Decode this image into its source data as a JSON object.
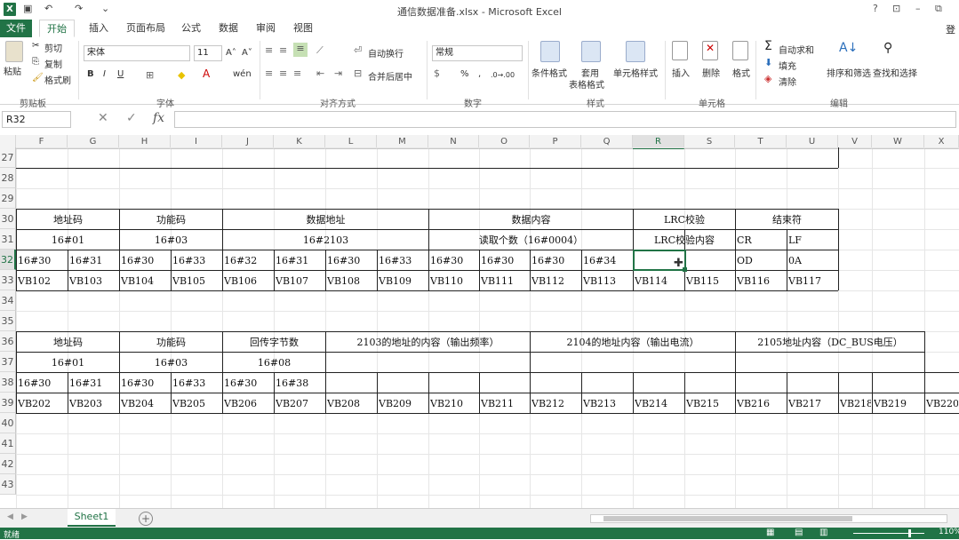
{
  "app": {
    "title": "通信数据准备.xlsx - Microsoft Excel",
    "help": "?",
    "restore": "⊡",
    "minimize": "–",
    "maximize": "⧉",
    "close": "✕",
    "login": "登"
  },
  "tabs": [
    "文件",
    "开始",
    "插入",
    "页面布局",
    "公式",
    "数据",
    "审阅",
    "视图"
  ],
  "ribbon": {
    "clipboard": {
      "paste": "粘贴",
      "cut": "剪切",
      "copy": "复制",
      "format_painter": "格式刷",
      "group": "剪贴板"
    },
    "font": {
      "name": "宋体",
      "size": "11",
      "bold": "B",
      "italic": "I",
      "underline": "U",
      "grow": "A˄",
      "shrink": "A˅",
      "wen": "wén",
      "group": "字体"
    },
    "align": {
      "wrap": "自动换行",
      "merge": "合并后居中",
      "group": "对齐方式"
    },
    "number": {
      "format": "常规",
      "percent": "%",
      "comma": ",",
      "inc": ".0→.00",
      "dec": ".00→.0",
      "group": "数字"
    },
    "styles": {
      "cond": "条件格式",
      "table_line1": "套用",
      "table_line2": "表格格式",
      "cell": "单元格样式",
      "group": "样式"
    },
    "cells": {
      "insert": "插入",
      "delete": "删除",
      "format": "格式",
      "group": "单元格"
    },
    "editing": {
      "autosum": "自动求和",
      "fill": "填充",
      "clear": "清除",
      "sort": "排序和筛选",
      "find": "查找和选择",
      "group": "编辑"
    }
  },
  "formula_bar": {
    "name_box": "R32",
    "fx": "fx",
    "value": ""
  },
  "columns": [
    "F",
    "G",
    "H",
    "I",
    "J",
    "K",
    "L",
    "M",
    "N",
    "O",
    "P",
    "Q",
    "R",
    "S",
    "T",
    "U",
    "V",
    "W",
    "X"
  ],
  "rows": [
    "27",
    "28",
    "29",
    "30",
    "31",
    "32",
    "33",
    "34",
    "35",
    "36",
    "37",
    "38",
    "39",
    "40",
    "41",
    "42",
    "43"
  ],
  "table1": {
    "headers": [
      {
        "text": "地址码"
      },
      {
        "text": "功能码"
      },
      {
        "text": "数据地址"
      },
      {
        "text": "数据内容"
      },
      {
        "text": "LRC校验"
      },
      {
        "text": "结束符"
      }
    ],
    "row31": [
      {
        "text": "16#01"
      },
      {
        "text": "16#03"
      },
      {
        "text": "16#2103"
      },
      {
        "text": "读取个数（16#0004）"
      },
      {
        "text": "LRC校验内容"
      },
      {
        "text": "CR"
      },
      {
        "text": "LF"
      }
    ],
    "row32": [
      "16#30",
      "16#31",
      "16#30",
      "16#33",
      "16#32",
      "16#31",
      "16#30",
      "16#33",
      "16#30",
      "16#30",
      "16#30",
      "16#34",
      "",
      "",
      "OD",
      "0A"
    ],
    "row33": [
      "VB102",
      "VB103",
      "VB104",
      "VB105",
      "VB106",
      "VB107",
      "VB108",
      "VB109",
      "VB110",
      "VB111",
      "VB112",
      "VB113",
      "VB114",
      "VB115",
      "VB116",
      "VB117"
    ]
  },
  "table2": {
    "headers": [
      {
        "text": "地址码"
      },
      {
        "text": "功能码"
      },
      {
        "text": "回传字节数"
      },
      {
        "text": "2103的地址的内容（输出频率）"
      },
      {
        "text": "2104的地址内容（输出电流）"
      },
      {
        "text": "2105地址内容（DC_BUS电压）"
      }
    ],
    "row37": [
      {
        "text": "16#01"
      },
      {
        "text": "16#03"
      },
      {
        "text": "16#08"
      }
    ],
    "row38": [
      "16#30",
      "16#31",
      "16#30",
      "16#33",
      "16#30",
      "16#38"
    ],
    "row39": [
      "VB202",
      "VB203",
      "VB204",
      "VB205",
      "VB206",
      "VB207",
      "VB208",
      "VB209",
      "VB210",
      "VB211",
      "VB212",
      "VB213",
      "VB214",
      "VB215",
      "VB216",
      "VB217",
      "VB218",
      "VB219",
      "VB220"
    ]
  },
  "sheet_tabs": [
    {
      "name": "Sheet1"
    }
  ],
  "add_sheet": "+",
  "status": {
    "ready": "就绪",
    "zoom": "110%"
  }
}
